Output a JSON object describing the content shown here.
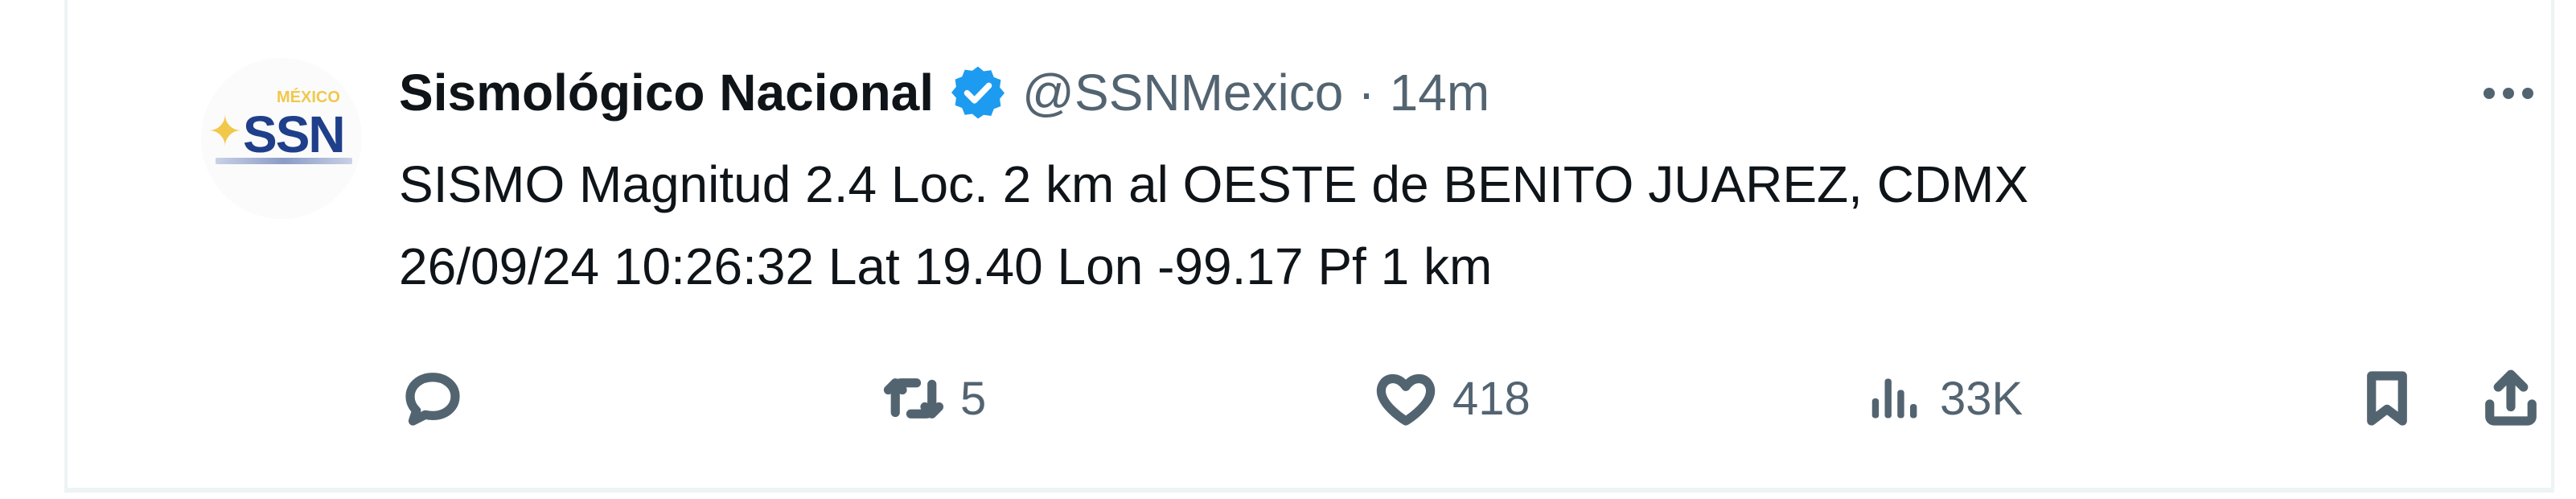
{
  "author": {
    "display_name": "Sismológico Nacional",
    "handle": "@SSNMexico",
    "separator": "·",
    "time": "14m",
    "avatar_logo_text": "SSN",
    "avatar_top_text": "MÉXICO"
  },
  "tweet": {
    "line1": "SISMO Magnitud 2.4 Loc. 2 km al OESTE de BENITO JUAREZ, CDMX",
    "line2": "26/09/24 10:26:32 Lat 19.40 Lon -99.17 Pf 1 km"
  },
  "actions": {
    "reply_count": "",
    "retweet_count": "5",
    "like_count": "418",
    "views_count": "33K"
  },
  "icons": {
    "verified": "verified-badge-icon",
    "more": "more-icon",
    "reply": "reply-icon",
    "retweet": "retweet-icon",
    "like": "heart-icon",
    "views": "views-icon",
    "bookmark": "bookmark-icon",
    "share": "share-icon"
  },
  "colors": {
    "accent": "#1d9bf0",
    "text": "#0f1419",
    "muted": "#536471",
    "border": "#eef3f4"
  }
}
